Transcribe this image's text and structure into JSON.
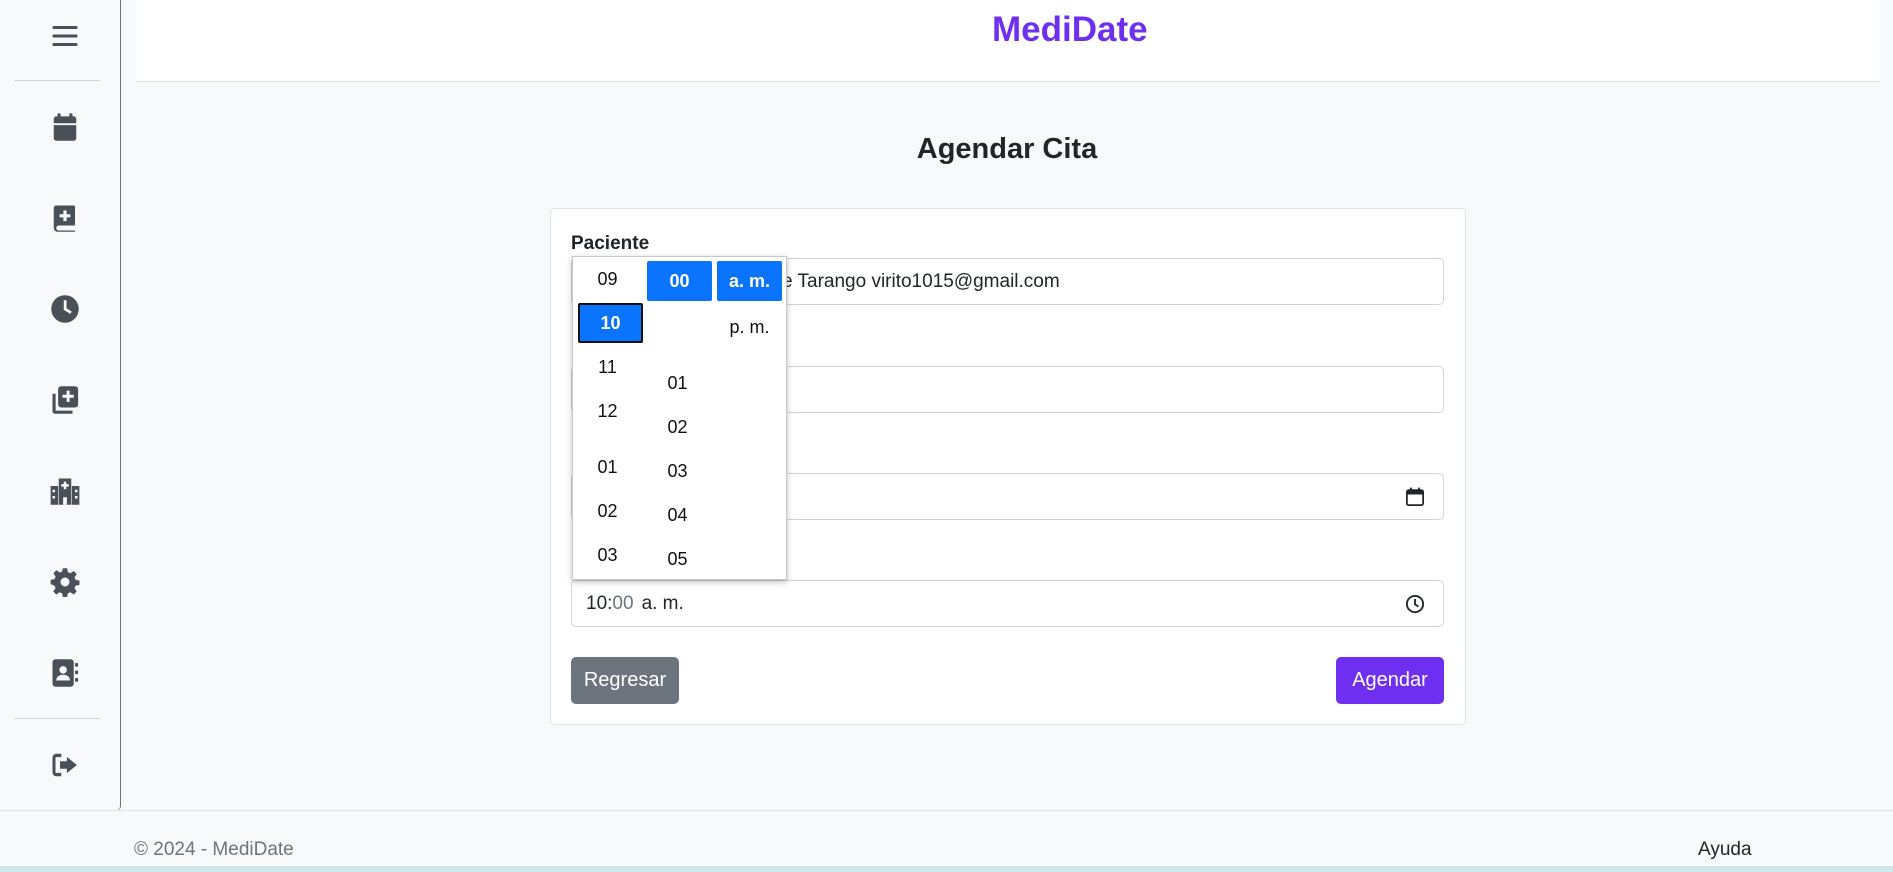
{
  "brand": "MediDate",
  "page_title": "Agendar Cita",
  "sidebar": {
    "icons": [
      "menu-icon",
      "calendar-icon",
      "book-medical-icon",
      "clock-icon",
      "add-copy-icon",
      "hospital-icon",
      "gear-icon",
      "contact-card-icon",
      "logout-icon"
    ]
  },
  "form": {
    "patient_label": "Paciente",
    "patient_value": "e Tarango virito1015@gmail.com",
    "time_hour": "10",
    "time_sep": ":",
    "time_minute": "00",
    "time_period": "a. m."
  },
  "time_picker": {
    "hours": [
      "09",
      "10",
      "11",
      "12",
      "01",
      "02",
      "03"
    ],
    "selected_hour": "10",
    "minutes": [
      "00",
      "01",
      "02",
      "03",
      "04",
      "05"
    ],
    "selected_minute": "00",
    "periods": [
      "a. m.",
      "p. m."
    ],
    "selected_period": "a. m."
  },
  "buttons": {
    "back": "Regresar",
    "schedule": "Agendar"
  },
  "footer": {
    "copyright": "© 2024 - MediDate",
    "help": "Ayuda"
  },
  "colors": {
    "brand": "#6f2ff0",
    "secondary": "#6c757d",
    "picker_selected": "#0a74ff"
  }
}
